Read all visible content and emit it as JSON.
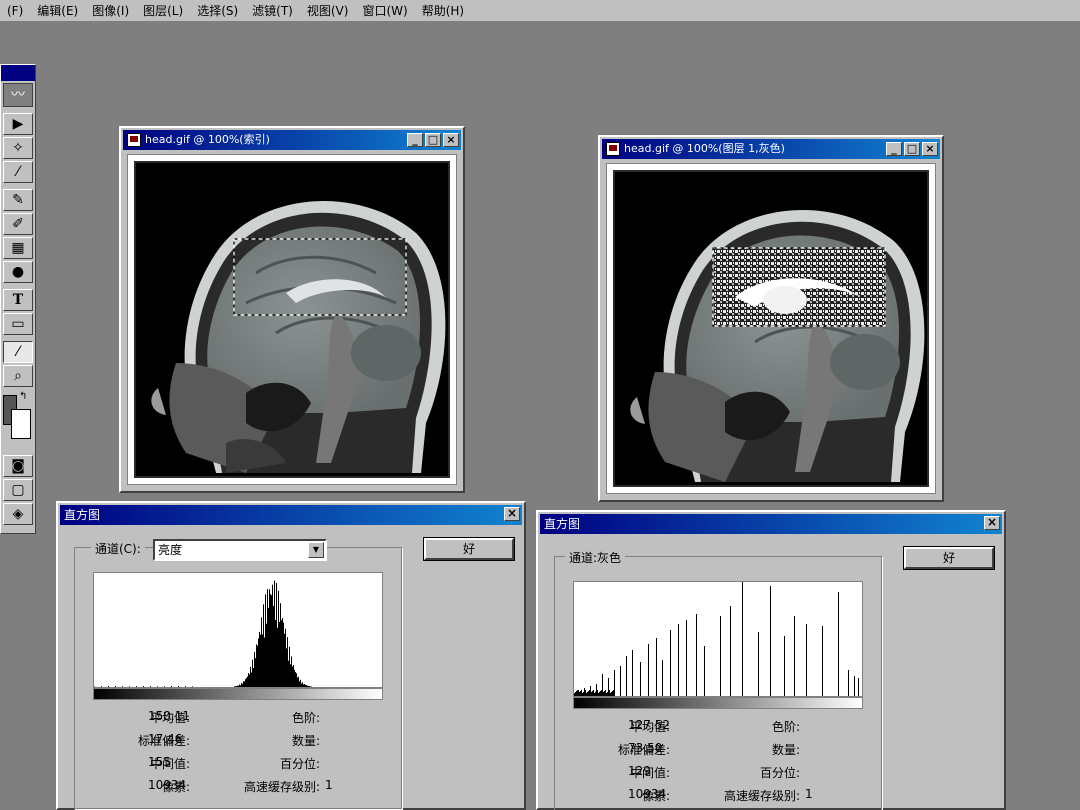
{
  "menu": {
    "items": [
      "(F)",
      "编辑(E)",
      "图像(I)",
      "图层(L)",
      "选择(S)",
      "滤镜(T)",
      "视图(V)",
      "窗口(W)",
      "帮助(H)"
    ]
  },
  "toolbox": {
    "tools": [
      "move-tool",
      "magic-wand-tool",
      "eyedropper-tool",
      "brush-tool",
      "history-brush-tool",
      "gradient-tool",
      "burn-tool",
      "type-tool",
      "rectangle-tool",
      "eyedropper-tool-2",
      "zoom-tool"
    ],
    "type_glyph": "T"
  },
  "window_left": {
    "title": "head.gif @ 100%(索引)"
  },
  "window_right": {
    "title": "head.gif @ 100%(图层 1,灰色)"
  },
  "hist_left": {
    "title": "直方图",
    "channel_label": "通道(C):",
    "channel_value": "亮度",
    "ok_label": "好",
    "stats": {
      "mean_label": "平均值:",
      "mean": "150.11",
      "std_label": "标准偏差:",
      "std": "17.46",
      "median_label": "中间值:",
      "median": "155",
      "pixels_label": "像素:",
      "pixels": "10934",
      "level_label": "色阶:",
      "count_label": "数量:",
      "percent_label": "百分位:",
      "cache_label": "高速缓存级别:",
      "cache": "1"
    }
  },
  "hist_right": {
    "title": "直方图",
    "channel_label": "通道:灰色",
    "ok_label": "好",
    "stats": {
      "mean_label": "平均值:",
      "mean": "127.52",
      "std_label": "标准偏差:",
      "std": "73.50",
      "median_label": "中间值:",
      "median": "129",
      "pixels_label": "像素:",
      "pixels": "10934",
      "level_label": "色阶:",
      "count_label": "数量:",
      "percent_label": "百分位:",
      "cache_label": "高速缓存级别:",
      "cache": "1"
    }
  },
  "colors": {
    "title_active": "#000080",
    "dialog_bg": "#c0c0c0",
    "desktop": "#7f7f7f"
  }
}
